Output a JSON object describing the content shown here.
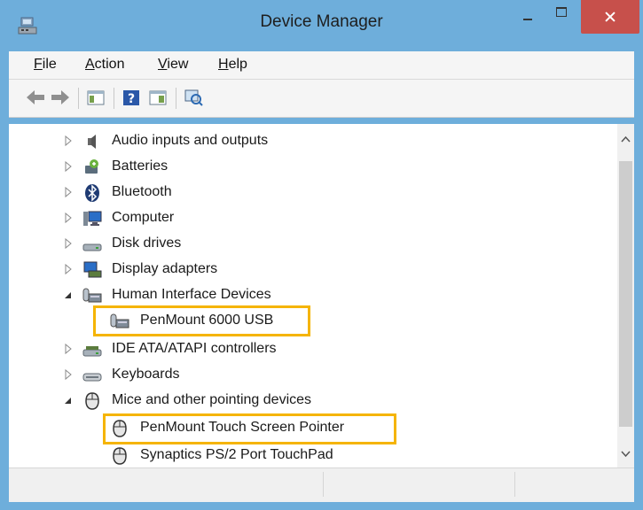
{
  "window": {
    "title": "Device Manager",
    "icon": "device-manager-icon",
    "controls": [
      "minimize-icon",
      "maximize-icon",
      "close-icon"
    ],
    "accent_close": "#c7504b",
    "frame_color": "#6eaedb"
  },
  "menu": {
    "items": [
      {
        "first": "F",
        "rest": "ile"
      },
      {
        "first": "A",
        "rest": "ction"
      },
      {
        "first": "V",
        "rest": "iew"
      },
      {
        "first": "H",
        "rest": "elp"
      }
    ]
  },
  "toolbar": {
    "buttons": [
      "back-arrow-icon",
      "forward-arrow-icon",
      "show-hide-console-tree-icon",
      "help-icon",
      "properties-pane-icon",
      "scan-hardware-icon"
    ]
  },
  "tree": {
    "items": [
      {
        "label": "Audio inputs and outputs",
        "icon": "speaker-icon",
        "expander": "closed"
      },
      {
        "label": "Batteries",
        "icon": "battery-icon",
        "expander": "closed"
      },
      {
        "label": "Bluetooth",
        "icon": "bluetooth-icon",
        "expander": "closed"
      },
      {
        "label": "Computer",
        "icon": "computer-icon",
        "expander": "closed"
      },
      {
        "label": "Disk drives",
        "icon": "disk-drive-icon",
        "expander": "closed"
      },
      {
        "label": "Display adapters",
        "icon": "display-adapter-icon",
        "expander": "closed"
      },
      {
        "label": "Human Interface Devices",
        "icon": "hid-icon",
        "expander": "open"
      },
      {
        "label": "PenMount 6000 USB",
        "icon": "hid-icon",
        "child": true,
        "highlight": true
      },
      {
        "label": "IDE ATA/ATAPI controllers",
        "icon": "ide-controller-icon",
        "expander": "closed"
      },
      {
        "label": "Keyboards",
        "icon": "keyboard-icon",
        "expander": "closed"
      },
      {
        "label": "Mice and other pointing devices",
        "icon": "mouse-icon",
        "expander": "open"
      },
      {
        "label": "PenMount Touch Screen Pointer",
        "icon": "mouse-icon",
        "child": true,
        "highlight": true
      },
      {
        "label": "Synaptics PS/2 Port TouchPad",
        "icon": "mouse-icon",
        "child": true
      }
    ],
    "highlight_color": "#f5b400"
  }
}
